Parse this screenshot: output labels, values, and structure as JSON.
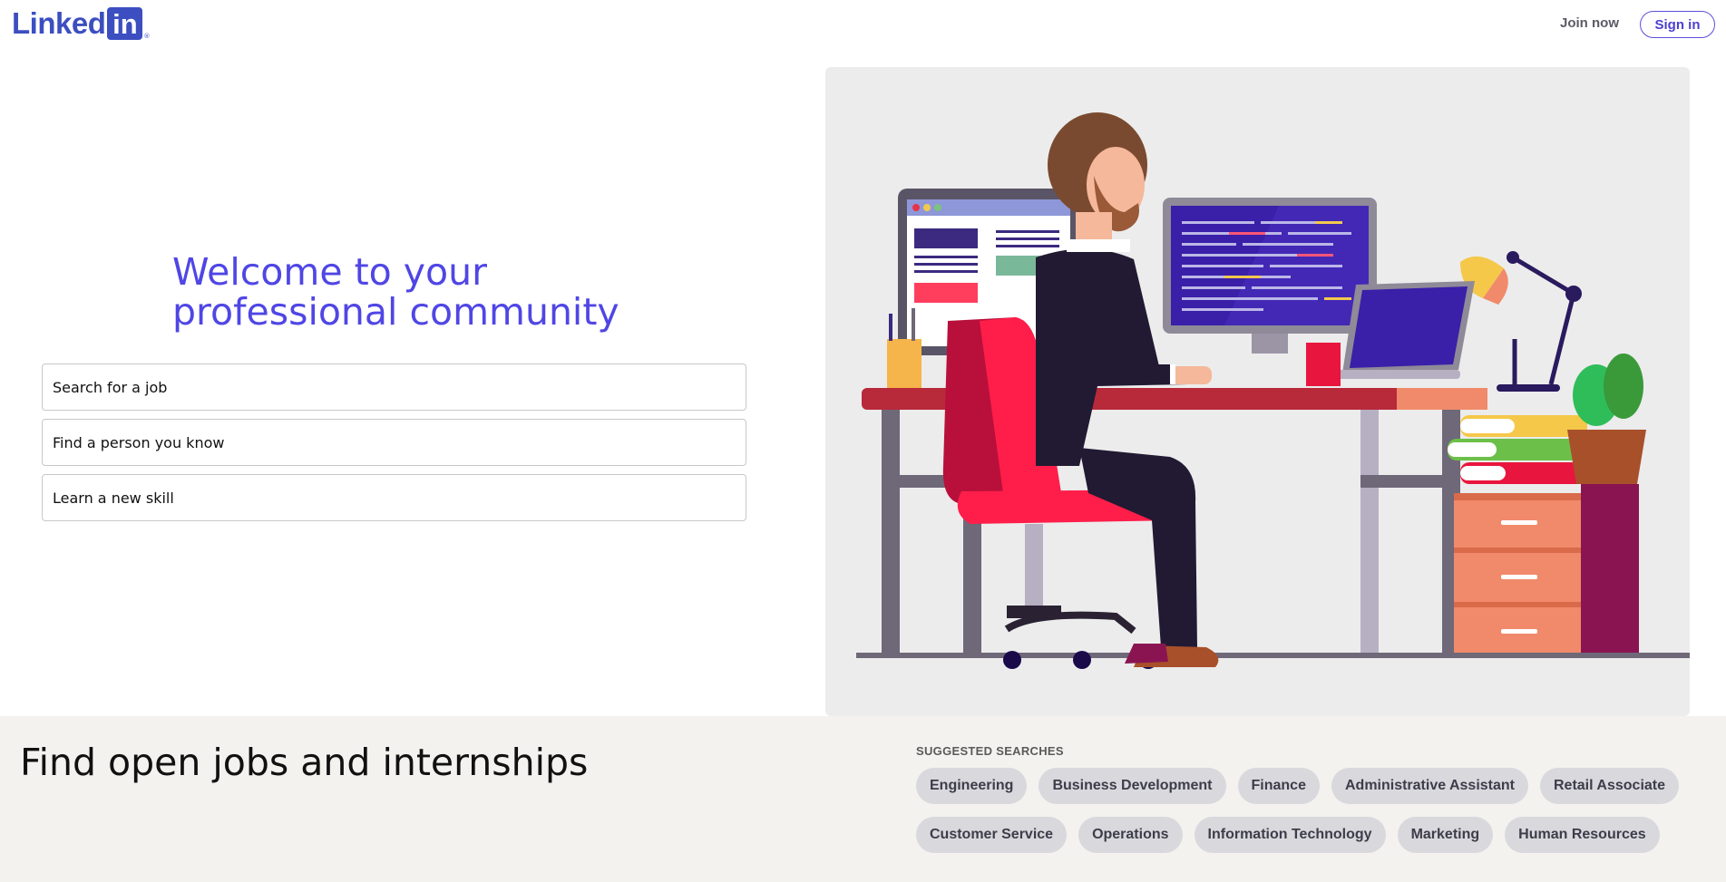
{
  "header": {
    "logo_text": "Linked",
    "logo_box_text": "in",
    "logo_reg": "®",
    "join_label": "Join now",
    "signin_label": "Sign in"
  },
  "hero": {
    "title_line1": "Welcome to your",
    "title_line2": "professional community",
    "options": [
      "Search for a job",
      "Find a person you know",
      "Learn a new skill"
    ]
  },
  "jobs": {
    "title": "Find open jobs and internships",
    "suggested_label": "SUGGESTED SEARCHES",
    "row1": [
      "Engineering",
      "Business Development",
      "Finance",
      "Administrative Assistant",
      "Retail Associate"
    ],
    "row2": [
      "Customer Service",
      "Operations",
      "Information Technology",
      "Marketing",
      "Human Resources"
    ]
  },
  "colors": {
    "brand": "#3c4ec0",
    "accent": "#4f46e5",
    "bottom_bg": "#f3f2ee",
    "pill_bg": "#d9d8dd"
  }
}
